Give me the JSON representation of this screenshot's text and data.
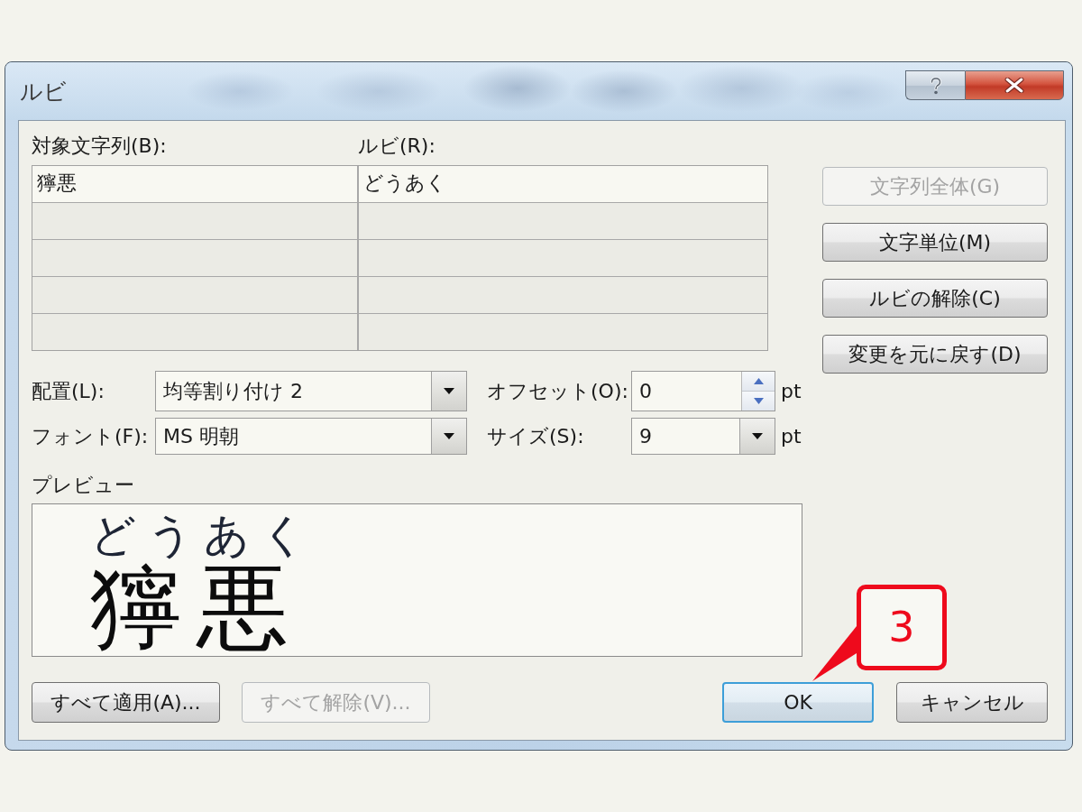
{
  "window": {
    "title": "ルビ"
  },
  "ruby_table": {
    "columns": [
      "対象文字列(B):",
      "ルビ(R):"
    ],
    "rows": [
      {
        "base": "獰悪",
        "ruby": "どうあく"
      },
      {},
      {},
      {},
      {}
    ]
  },
  "side_buttons": [
    {
      "label": "文字列全体(G)",
      "disabled": true
    },
    {
      "label": "文字単位(M)",
      "disabled": false
    },
    {
      "label": "ルビの解除(C)",
      "disabled": false
    },
    {
      "label": "変更を元に戻す(D)",
      "disabled": false
    }
  ],
  "fields": [
    {
      "kind": "combo",
      "label": "配置(L):",
      "value": "均等割り付け 2"
    },
    {
      "kind": "spin",
      "label": "オフセット(O):",
      "value": "0",
      "unit": "pt"
    },
    {
      "kind": "combo",
      "label": "フォント(F):",
      "value": "MS 明朝"
    },
    {
      "kind": "combo",
      "label": "サイズ(S):",
      "value": "9",
      "unit": "pt"
    }
  ],
  "preview": {
    "label": "プレビュー",
    "ruby": "どうあく",
    "base": "獰悪"
  },
  "bottom_buttons": [
    {
      "label": "すべて適用(A)...",
      "disabled": false
    },
    {
      "label": "すべて解除(V)...",
      "disabled": true
    }
  ],
  "dialog_buttons": [
    {
      "label": "OK",
      "default": true
    },
    {
      "label": "キャンセル",
      "default": false
    }
  ],
  "annotation": {
    "label": "3"
  }
}
